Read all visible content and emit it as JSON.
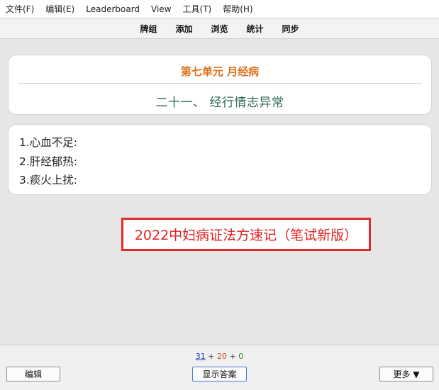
{
  "menubar": {
    "items": [
      "文件(F)",
      "编辑(E)",
      "Leaderboard",
      "View",
      "工具(T)",
      "帮助(H)"
    ]
  },
  "toolbar": {
    "links": [
      "牌组",
      "添加",
      "浏览",
      "统计",
      "同步"
    ]
  },
  "card": {
    "unit_title": "第七单元 月经病",
    "section_title": "二十一、 经行情志异常",
    "lines": [
      "1.心血不足:",
      "2.肝经郁热:",
      "3.痰火上扰:"
    ]
  },
  "stamp": {
    "text": "2022中妇病证法方速记（笔试新版）"
  },
  "bottom": {
    "counts": {
      "new": "31",
      "learning": "20",
      "review": "0",
      "separator": "+"
    },
    "edit_label": "编辑",
    "show_answer_label": "显示答案",
    "more_label": "更多 ▼"
  },
  "colors": {
    "unit_title": "#e0701a",
    "section_title": "#2e6b52",
    "stamp": "#e02020",
    "count_new": "#1a3fb0",
    "count_learning": "#c35617",
    "count_review": "#2b8a2b"
  }
}
